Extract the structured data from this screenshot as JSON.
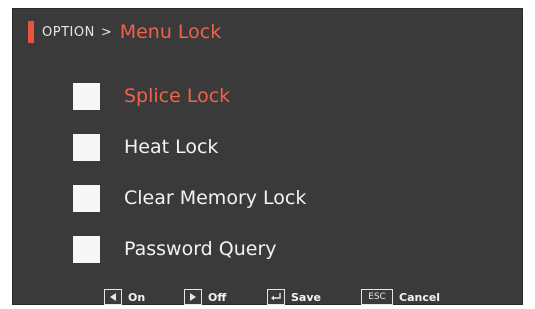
{
  "header": {
    "breadcrumb": "OPTION",
    "separator": ">",
    "title": "Menu Lock"
  },
  "menu": {
    "items": [
      {
        "label": "Splice Lock",
        "checked": false,
        "selected": true
      },
      {
        "label": "Heat Lock",
        "checked": false,
        "selected": false
      },
      {
        "label": "Clear Memory Lock",
        "checked": false,
        "selected": false
      },
      {
        "label": "Password Query",
        "checked": false,
        "selected": false
      }
    ]
  },
  "footer": {
    "hints": [
      {
        "key": "left-arrow-icon",
        "label": "On"
      },
      {
        "key": "right-arrow-icon",
        "label": "Off"
      },
      {
        "key": "enter-key-icon",
        "label": "Save"
      },
      {
        "key_text": "ESC",
        "label": "Cancel"
      }
    ]
  },
  "colors": {
    "accent": "#e8553c",
    "background": "#3a3a3a",
    "text": "#f2f2f2",
    "selected_text": "#f0624a",
    "checkbox": "#f7f7f7"
  }
}
